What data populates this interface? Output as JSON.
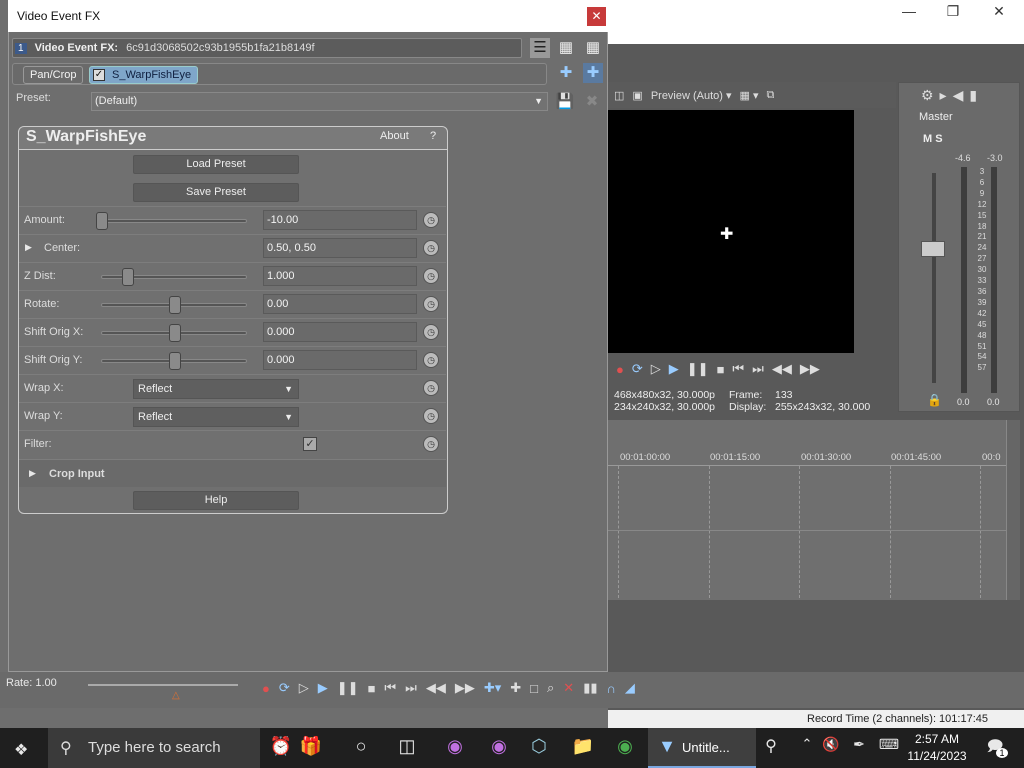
{
  "background_app": {
    "preview": {
      "mode": "Preview (Auto)",
      "info": {
        "project": "468x480x32, 30.000p",
        "preview": "234x240x32, 30.000p",
        "frame_label": "Frame:",
        "frame": "133",
        "display_label": "Display:",
        "display": "255x243x32, 30.000"
      }
    },
    "master": {
      "label": "Master",
      "peak_left": "-4.6",
      "peak_right": "-3.0",
      "scale": [
        "3",
        "6",
        "9",
        "12",
        "15",
        "18",
        "21",
        "24",
        "27",
        "30",
        "33",
        "36",
        "39",
        "42",
        "45",
        "48",
        "51",
        "54",
        "57"
      ],
      "bottom_left": "0.0",
      "bottom_right": "0.0"
    },
    "timeline": {
      "ticks": [
        "00:01:00:00",
        "00:01:15:00",
        "00:01:30:00",
        "00:01:45:00",
        "00:0"
      ]
    },
    "rate": "Rate: 1.00",
    "status": "Record Time (2 channels): 101:17:45"
  },
  "dialog": {
    "title": "Video Event FX",
    "chain": {
      "badge": "1",
      "label": "Video Event FX:",
      "hash": "6c91d3068502c93b1955b1fa21b8149f"
    },
    "tabs": [
      "Pan/Crop",
      "S_WarpFishEye"
    ],
    "preset_label": "Preset:",
    "preset_value": "(Default)",
    "plugin": {
      "name": "S_WarpFishEye",
      "about": "About",
      "help_q": "?",
      "load_preset": "Load Preset",
      "save_preset": "Save Preset",
      "help": "Help",
      "params": [
        {
          "label": "Amount:",
          "value": "-10.00",
          "level": 0.0
        },
        {
          "label": "Center:",
          "value": "0.50, 0.50"
        },
        {
          "label": "Z Dist:",
          "value": "1.000",
          "level": 0.18
        },
        {
          "label": "Rotate:",
          "value": "0.00",
          "level": 0.5
        },
        {
          "label": "Shift Orig X:",
          "value": "0.000",
          "level": 0.5
        },
        {
          "label": "Shift Orig Y:",
          "value": "0.000",
          "level": 0.5
        },
        {
          "label": "Wrap X:",
          "value": "Reflect"
        },
        {
          "label": "Wrap Y:",
          "value": "Reflect"
        },
        {
          "label": "Filter:",
          "checked": true
        },
        {
          "label": "Crop Input"
        }
      ]
    }
  },
  "taskbar": {
    "search_placeholder": "Type here to search",
    "active_app": "Untitle...",
    "time": "2:57 AM",
    "date": "11/24/2023",
    "notif_count": "1"
  }
}
